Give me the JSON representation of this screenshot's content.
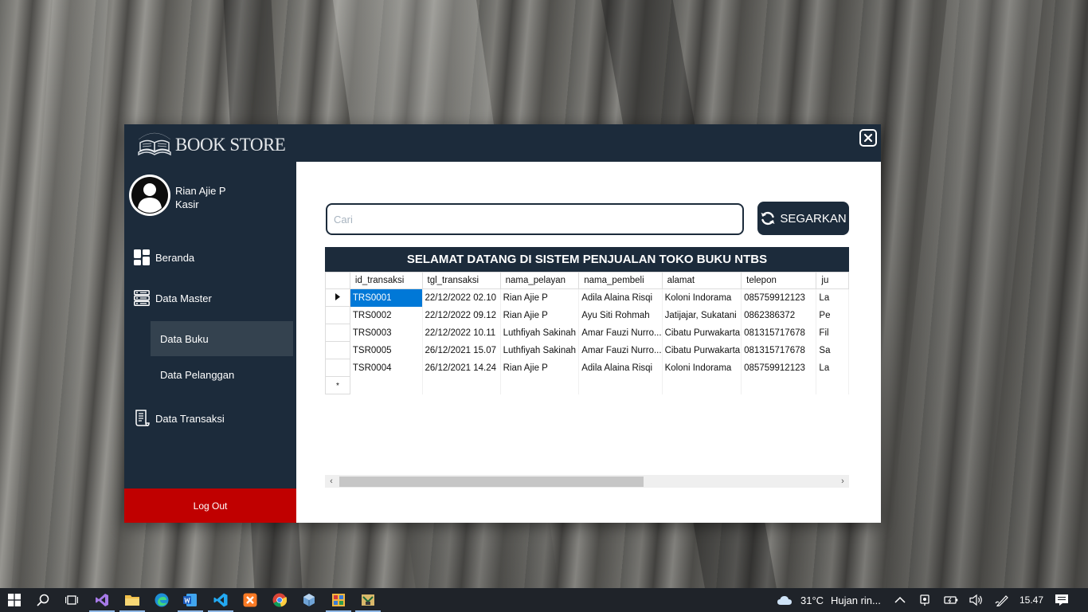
{
  "app": {
    "title": "BOOK STORE",
    "logo_arc": "BOOK STORE"
  },
  "user": {
    "name": "Rian Ajie P",
    "role": "Kasir"
  },
  "nav": {
    "beranda": "Beranda",
    "data_master": "Data Master",
    "data_buku": "Data Buku",
    "data_pelanggan": "Data Pelanggan",
    "data_transaksi": "Data Transaksi",
    "logout": "Log Out"
  },
  "search": {
    "placeholder": "Cari",
    "value": ""
  },
  "refresh_label": "SEGARKAN",
  "banner": "SELAMAT DATANG DI SISTEM PENJUALAN TOKO BUKU NTBS",
  "table": {
    "columns": [
      "id_transaksi",
      "tgl_transaksi",
      "nama_pelayan",
      "nama_pembeli",
      "alamat",
      "telepon",
      "ju"
    ],
    "rows": [
      [
        "TRS0001",
        "22/12/2022 02.10",
        "Rian Ajie P",
        "Adila Alaina Risqi",
        "Koloni Indorama",
        "085759912123",
        "La"
      ],
      [
        "TRS0002",
        "22/12/2022 09.12",
        "Rian Ajie P",
        "Ayu Siti Rohmah",
        "Jatijajar, Sukatani",
        "0862386372",
        "Pe"
      ],
      [
        "TRS0003",
        "22/12/2022 10.11",
        "Luthfiyah Sakinah",
        "Amar Fauzi Nurro...",
        "Cibatu Purwakarta",
        "081315717678",
        "Fil"
      ],
      [
        "TSR0005",
        "26/12/2021 15.07",
        "Luthfiyah Sakinah",
        "Amar Fauzi Nurro...",
        "Cibatu Purwakarta",
        "081315717678",
        "Sa"
      ],
      [
        "TSR0004",
        "26/12/2021 14.24",
        "Rian Ajie P",
        "Adila Alaina Risqi",
        "Koloni Indorama",
        "085759912123",
        "La"
      ]
    ],
    "selected_row": 0,
    "horizontal_scroll_fraction": 0.59
  },
  "taskbar": {
    "weather_temp": "31°C",
    "weather_text": "Hujan rin...",
    "clock": "15.47",
    "icons": [
      "windows-start-icon",
      "search-icon",
      "task-view-icon",
      "visual-studio-icon",
      "file-explorer-icon",
      "edge-icon",
      "word-icon",
      "vscode-icon",
      "xampp-icon",
      "chrome-icon",
      "virtualbox-icon",
      "app-icon",
      "bookstore-app-icon"
    ]
  },
  "colors": {
    "primary": "#1c2b3b",
    "accent_red": "#c00000",
    "selection": "#0078d7"
  }
}
